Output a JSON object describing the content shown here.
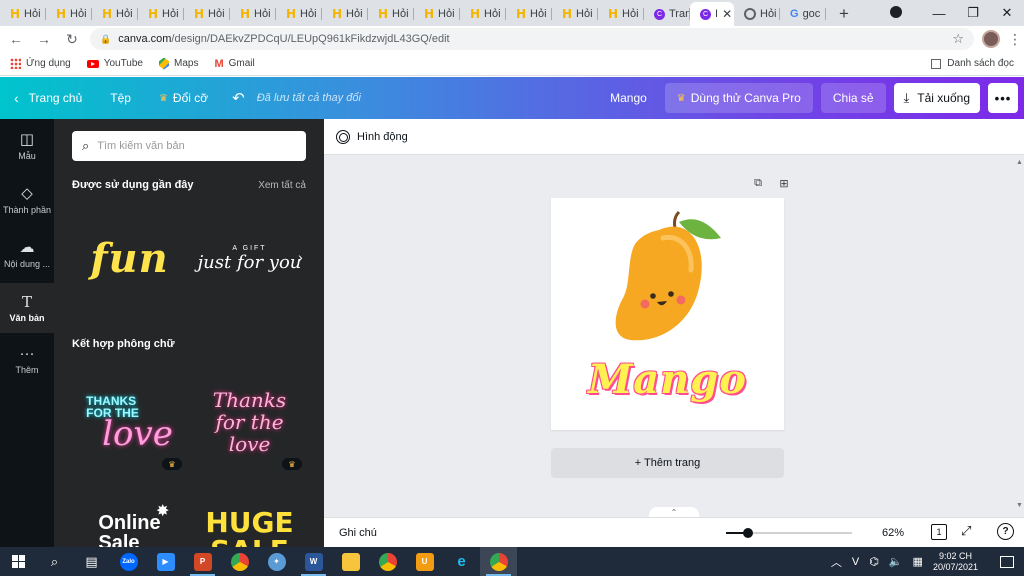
{
  "browser": {
    "tabs": [
      {
        "title": "Hỏi",
        "icon": "h"
      },
      {
        "title": "Hỏi",
        "icon": "h"
      },
      {
        "title": "Hỏi",
        "icon": "h"
      },
      {
        "title": "Hỏi",
        "icon": "h"
      },
      {
        "title": "Hỏi",
        "icon": "h"
      },
      {
        "title": "Hỏi",
        "icon": "h"
      },
      {
        "title": "Hỏi",
        "icon": "h"
      },
      {
        "title": "Hỏi",
        "icon": "h"
      },
      {
        "title": "Hỏi",
        "icon": "h"
      },
      {
        "title": "Hỏi",
        "icon": "h"
      },
      {
        "title": "Hỏi",
        "icon": "h"
      },
      {
        "title": "Hỏi",
        "icon": "h"
      },
      {
        "title": "Hỏi",
        "icon": "h"
      },
      {
        "title": "Hỏi",
        "icon": "h"
      },
      {
        "title": "Tran",
        "icon": "canva"
      },
      {
        "title": "I",
        "icon": "canva",
        "active": true
      },
      {
        "title": "Hỏi",
        "icon": "moodle"
      },
      {
        "title": "goc",
        "icon": "google"
      }
    ],
    "new_tab": "+",
    "url_host": "canva.com",
    "url_path": "/design/DAEkvZPDCqU/LEUpQ961kFikdzwjdL43GQ/edit",
    "bookmarks": [
      {
        "label": "Ứng dụng",
        "icon": "apps-grid-icon"
      },
      {
        "label": "YouTube",
        "icon": "youtube-icon"
      },
      {
        "label": "Maps",
        "icon": "maps-icon"
      },
      {
        "label": "Gmail",
        "icon": "gmail-icon"
      }
    ],
    "reading_list": "Danh sách đọc"
  },
  "header": {
    "home": "Trang chủ",
    "file": "Tệp",
    "resize": "Đổi cỡ",
    "saved_status": "Đã lưu tất cả thay đổi",
    "design_title": "Mango",
    "try_pro": "Dùng thử Canva Pro",
    "share": "Chia sẻ",
    "download": "Tải xuống",
    "more": "•••"
  },
  "rail": {
    "items": [
      {
        "label": "Mẫu",
        "icon": "template-icon"
      },
      {
        "label": "Thành phần",
        "icon": "elements-icon"
      },
      {
        "label": "Nội dung ...",
        "icon": "uploads-icon"
      },
      {
        "label": "Văn bản",
        "icon": "text-icon",
        "active": true
      },
      {
        "label": "Thêm",
        "icon": "more-icon"
      }
    ]
  },
  "panel": {
    "search_placeholder": "Tìm kiếm văn bản",
    "recent_title": "Được sử dụng gần đây",
    "see_all": "Xem tất cả",
    "recent_items": [
      {
        "text": "fun"
      },
      {
        "small": "A GIFT",
        "script": "just for you"
      }
    ],
    "combos_title": "Kết hợp phông chữ",
    "combo_items": [
      {
        "line1": "THANKS",
        "line2": "FOR THE",
        "line3": "love"
      },
      {
        "line1": "Thanks",
        "line2": "for the love"
      },
      {
        "line1": "Online",
        "line2": "Sale"
      },
      {
        "line1": "HUGE",
        "line2": "SALE"
      }
    ]
  },
  "editor": {
    "animate": "Hình động",
    "design_text": "Mango",
    "add_page": "+ Thêm trang",
    "notes": "Ghi chú",
    "zoom_percent": 62,
    "zoom_label": "62%",
    "page_count": "1",
    "help": "?"
  },
  "taskbar": {
    "apps": [
      "search",
      "task-view",
      "zalo",
      "zoom",
      "powerpoint",
      "chrome",
      "edge-old",
      "word",
      "explorer",
      "chrome-2",
      "unikey",
      "ie",
      "chrome-active"
    ],
    "zalo": "Zalo",
    "time": "9:02 CH",
    "date": "20/07/2021",
    "lang": "V"
  },
  "colors": {
    "header_gradient_start": "#00c4cc",
    "header_gradient_end": "#7d2ae8",
    "rail_bg": "#0e1318",
    "panel_bg": "#252627",
    "canvas_bg": "#ebecf0",
    "mango_text": "#fff14f",
    "mango_outline": "#ff4d8d",
    "mango_body": "#f7a823",
    "leaf": "#6db33f"
  }
}
